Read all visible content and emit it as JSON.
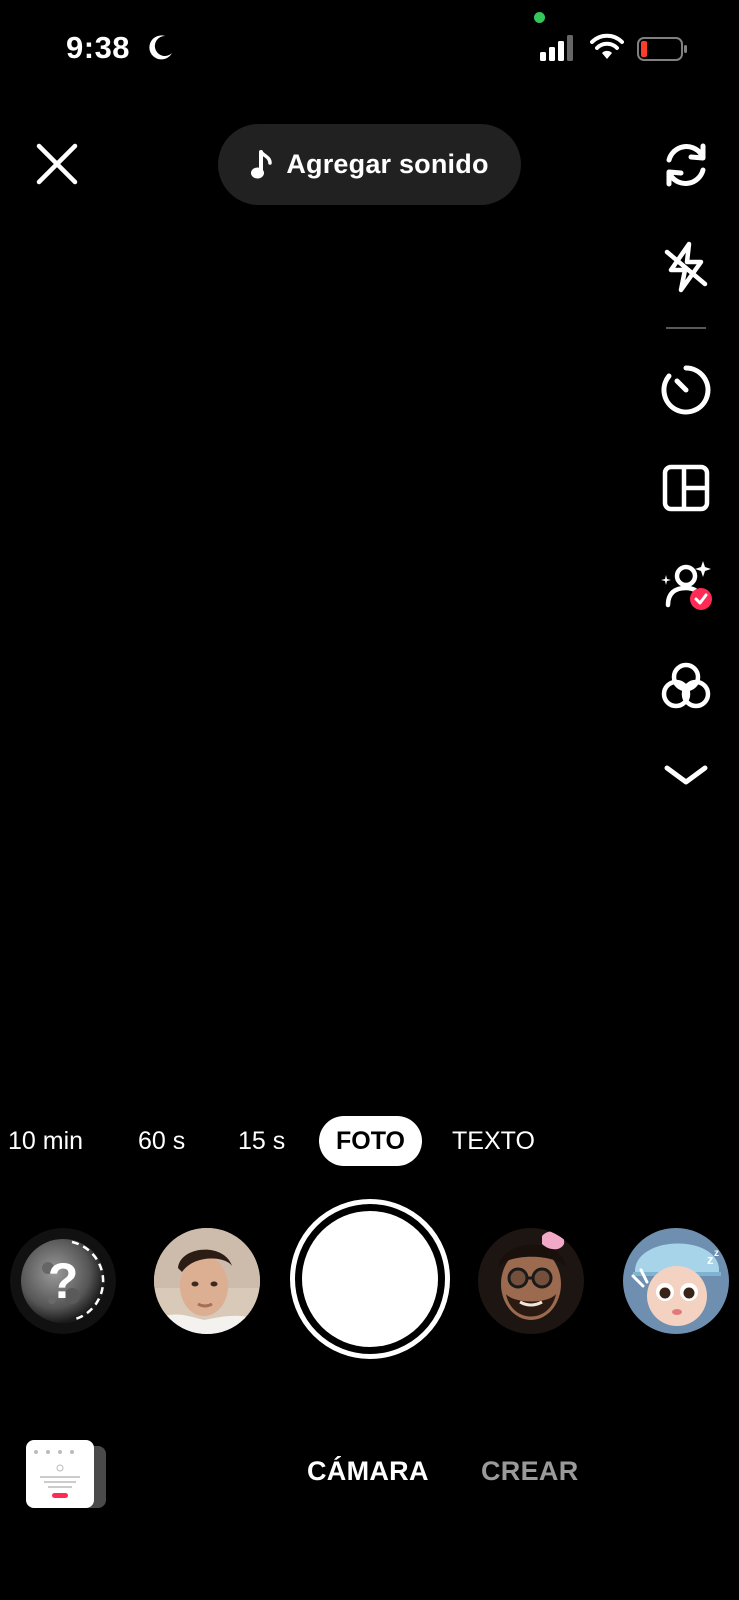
{
  "status_bar": {
    "time": "9:38",
    "icons": [
      "moon-icon",
      "signal-icon",
      "wifi-icon",
      "battery-icon"
    ],
    "battery_color": "#ff3b30",
    "privacy_dot_color": "#34c759"
  },
  "top_bar": {
    "close_icon": "close-icon",
    "add_sound_label": "Agregar sonido",
    "add_sound_icon": "music-note-icon"
  },
  "right_tools": [
    {
      "name": "flip-camera-icon"
    },
    {
      "name": "flash-off-icon"
    },
    {
      "name": "timer-icon"
    },
    {
      "name": "layout-icon"
    },
    {
      "name": "retouch-icon",
      "badge_color": "#fe2c55"
    },
    {
      "name": "filters-icon"
    },
    {
      "name": "chevron-down-icon"
    }
  ],
  "modes": {
    "items": [
      "10 min",
      "60 s",
      "15 s",
      "FOTO",
      "TEXTO"
    ],
    "active": "FOTO"
  },
  "effects": [
    {
      "name": "random-effect-icon",
      "label": "?"
    },
    {
      "name": "effect-face-1"
    },
    {
      "name": "effect-face-2"
    },
    {
      "name": "effect-cartoon-girl"
    }
  ],
  "bottom_tabs": {
    "camera": "CÁMARA",
    "create": "CREAR"
  }
}
